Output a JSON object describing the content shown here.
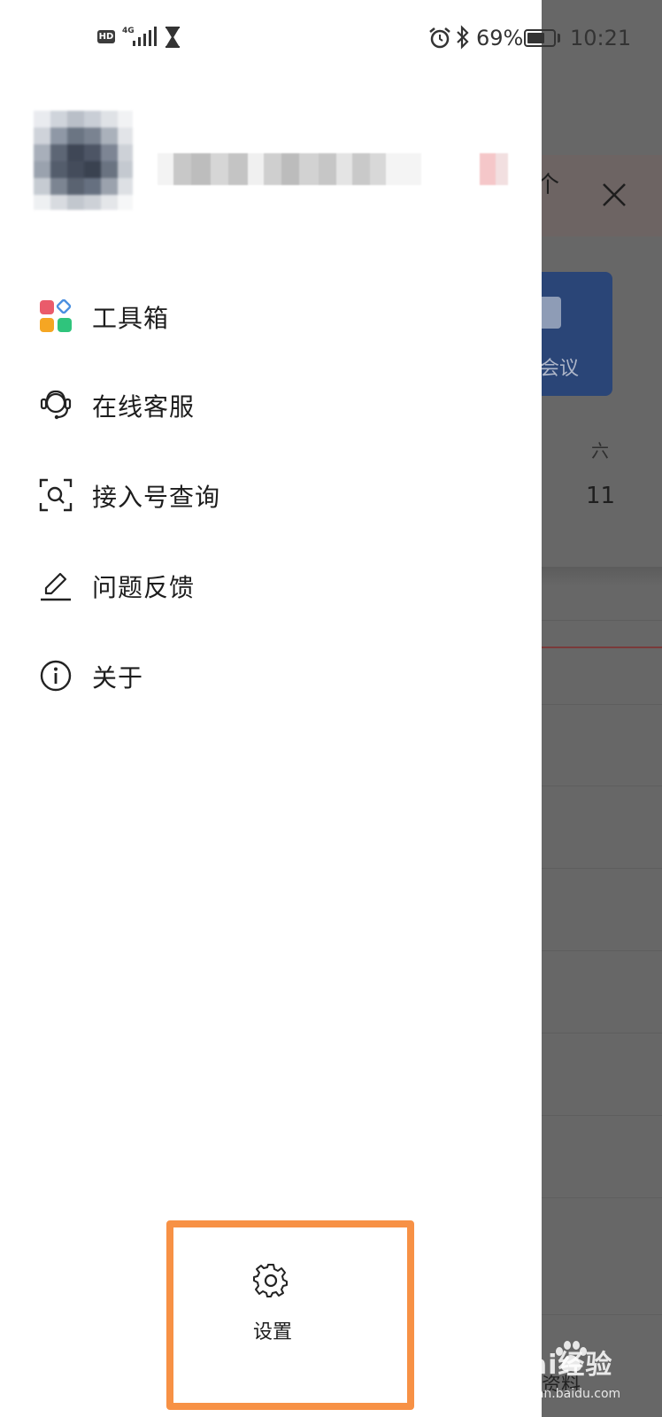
{
  "status_bar": {
    "hd": "HD",
    "network": "4G",
    "battery_percent": "69%",
    "battery_level": 0.69,
    "time": "10:21",
    "icons": [
      "hd-icon",
      "signal-icon",
      "hourglass-icon",
      "alarm-icon",
      "bluetooth-icon",
      "battery-icon"
    ]
  },
  "profile": {
    "avatar": "blurred-avatar",
    "name_blurred": true
  },
  "menu": [
    {
      "label": "工具箱",
      "icon": "toolbox-icon"
    },
    {
      "label": "在线客服",
      "icon": "customer-service-icon"
    },
    {
      "label": "接入号查询",
      "icon": "scan-search-icon"
    },
    {
      "label": "问题反馈",
      "icon": "pen-icon"
    },
    {
      "label": "关于",
      "icon": "info-icon"
    }
  ],
  "settings": {
    "label": "设置",
    "icon": "gear-icon",
    "highlight_color": "#f79145"
  },
  "background": {
    "partial_text": "个",
    "close_icon": "close-icon",
    "card_label": "会议",
    "weekday": "六",
    "day_number": "11",
    "bottom_label": "资料"
  },
  "watermark": {
    "text": "Bai经验",
    "url": "jingyan.baidu.com"
  },
  "colors": {
    "drawer_bg": "#ffffff",
    "overlay": "#676767",
    "highlight": "#f79145",
    "text": "#1d1d1d",
    "toolbox_red": "#ea5b6b",
    "toolbox_blue": "#4a8fe0",
    "toolbox_orange": "#f5a623",
    "toolbox_green": "#2fc47c"
  }
}
